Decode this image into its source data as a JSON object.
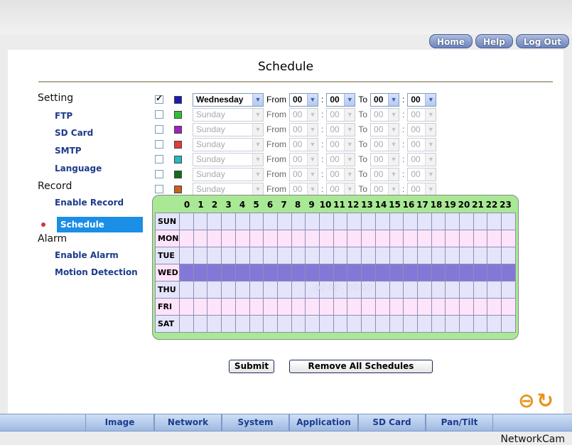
{
  "top_nav": {
    "home": "Home",
    "help": "Help",
    "logout": "Log Out"
  },
  "page": {
    "title": "Schedule"
  },
  "sidebar": {
    "setting": "Setting",
    "ftp": "FTP",
    "sd_card": "SD Card",
    "smtp": "SMTP",
    "language": "Language",
    "record": "Record",
    "enable_record": "Enable Record",
    "schedule": "Schedule",
    "alarm": "Alarm",
    "enable_alarm": "Enable Alarm",
    "motion_detection": "Motion Detection"
  },
  "labels": {
    "from": "From",
    "to": "To",
    "colon": ":"
  },
  "schedules": [
    {
      "checked": true,
      "color": "#1a1ab8",
      "day": "Wednesday",
      "from_h": "00",
      "from_m": "00",
      "to_h": "00",
      "to_m": "00"
    },
    {
      "checked": false,
      "color": "#2fbf3a",
      "day": "Sunday",
      "from_h": "00",
      "from_m": "00",
      "to_h": "00",
      "to_m": "00"
    },
    {
      "checked": false,
      "color": "#a21fc2",
      "day": "Sunday",
      "from_h": "00",
      "from_m": "00",
      "to_h": "00",
      "to_m": "00"
    },
    {
      "checked": false,
      "color": "#e23a3a",
      "day": "Sunday",
      "from_h": "00",
      "from_m": "00",
      "to_h": "00",
      "to_m": "00"
    },
    {
      "checked": false,
      "color": "#28b9c0",
      "day": "Sunday",
      "from_h": "00",
      "from_m": "00",
      "to_h": "00",
      "to_m": "00"
    },
    {
      "checked": false,
      "color": "#176b18",
      "day": "Sunday",
      "from_h": "00",
      "from_m": "00",
      "to_h": "00",
      "to_m": "00"
    },
    {
      "checked": false,
      "color": "#c8601c",
      "day": "Sunday",
      "from_h": "00",
      "from_m": "00",
      "to_h": "00",
      "to_m": "00"
    }
  ],
  "grid": {
    "hours": [
      "0",
      "1",
      "2",
      "3",
      "4",
      "5",
      "6",
      "7",
      "8",
      "9",
      "10",
      "11",
      "12",
      "13",
      "14",
      "15",
      "16",
      "17",
      "18",
      "19",
      "20",
      "21",
      "22",
      "23"
    ],
    "days": [
      "SUN",
      "MON",
      "TUE",
      "WED",
      "THU",
      "FRI",
      "SAT"
    ],
    "wed_label": "00:00 - 00:00"
  },
  "buttons": {
    "submit": "Submit",
    "remove_all": "Remove All Schedules"
  },
  "bottom_tabs": [
    "Image",
    "Network",
    "System",
    "Application",
    "SD Card",
    "Pan/Tilt"
  ],
  "brand": "NetworkCam"
}
